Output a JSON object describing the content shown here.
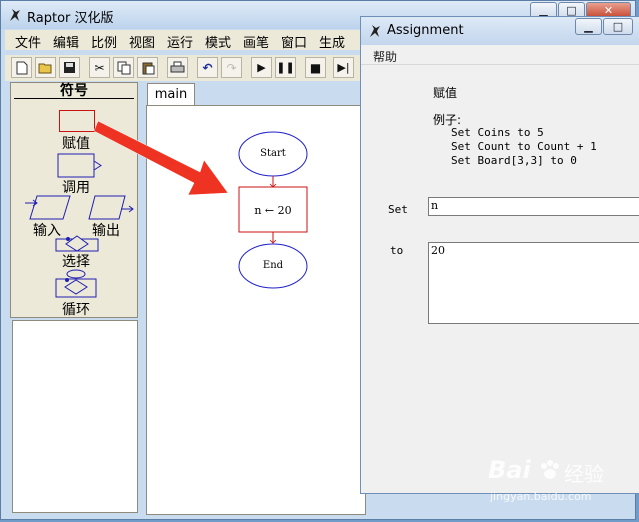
{
  "raptor": {
    "title": "Raptor 汉化版",
    "menu": [
      "文件",
      "编辑",
      "比例",
      "视图",
      "运行",
      "模式",
      "画笔",
      "窗口",
      "生成"
    ],
    "symbols_title": "符号",
    "symbols": [
      "赋值",
      "调用",
      "输入",
      "输出",
      "选择",
      "循环"
    ],
    "tab": "main",
    "flow": {
      "start": "Start",
      "assign": "n ← 20",
      "end": "End"
    }
  },
  "dialog": {
    "title": "Assignment",
    "menu": "帮助",
    "heading": "赋值",
    "example_label": "例子:",
    "examples": [
      "Set Coins to 5",
      "Set Count to Count + 1",
      "Set Board[3,3] to 0"
    ],
    "set_label": "Set",
    "set_value": "n",
    "to_label": "to",
    "to_value": "20"
  },
  "watermark": {
    "brand": "Bai",
    "brand2": "经验",
    "site": "jingyan.baidu.com"
  },
  "colors": {
    "arrow": "#ee3322",
    "flow_oval": "#1f1fd0",
    "flow_box": "#cc1111",
    "symbol_blue": "#1f1fb0",
    "symbol_red": "#cc1111"
  }
}
